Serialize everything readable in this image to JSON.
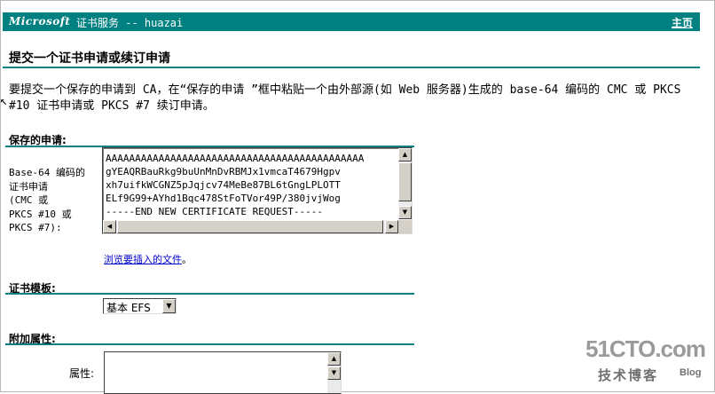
{
  "header": {
    "brand": "Microsoft",
    "title": "证书服务 --  huazai",
    "home_link": "主页"
  },
  "page_title": "提交一个证书申请或续订申请",
  "intro_text": "要提交一个保存的申请到 CA，在“保存的申请 ”框中粘贴一个由外部源(如 Web 服务器)生成的 base-64 编码的 CMC 或 PKCS #10 证书申请或 PKCS #7 续订申请。",
  "saved_request": {
    "section_label": "保存的申请:",
    "field_label": "Base-64 编码的\n证书申请\n(CMC 或\nPKCS #10 或\nPKCS #7):",
    "content_lines": [
      "AAAAAAAAAAAAAAAAAAAAAAAAAAAAAAAAAAAAAAAAAAAA",
      "gYEAQRBauRkg9buUnMnDvRBMJx1vmcaT4679Hgpv",
      "xh7uifkWCGNZ5pJqjcv74MeBe87BL6tGngLPLOTT",
      "ELf9G99+AYhd1Bqc478StFoTVor49P/380jvjWog",
      "-----END NEW CERTIFICATE REQUEST-----"
    ],
    "browse_link_text": "浏览要插入的文件",
    "browse_suffix": "。"
  },
  "template": {
    "section_label": "证书模板:",
    "selected": "基本 EFS"
  },
  "attributes": {
    "section_label": "附加属性:",
    "field_label": "属性:",
    "value": ""
  },
  "watermark": {
    "site": "51CTO.com",
    "label": "技术博客",
    "blog": "Blog"
  },
  "colors": {
    "accent": "#008080",
    "link": "#0000cc"
  }
}
